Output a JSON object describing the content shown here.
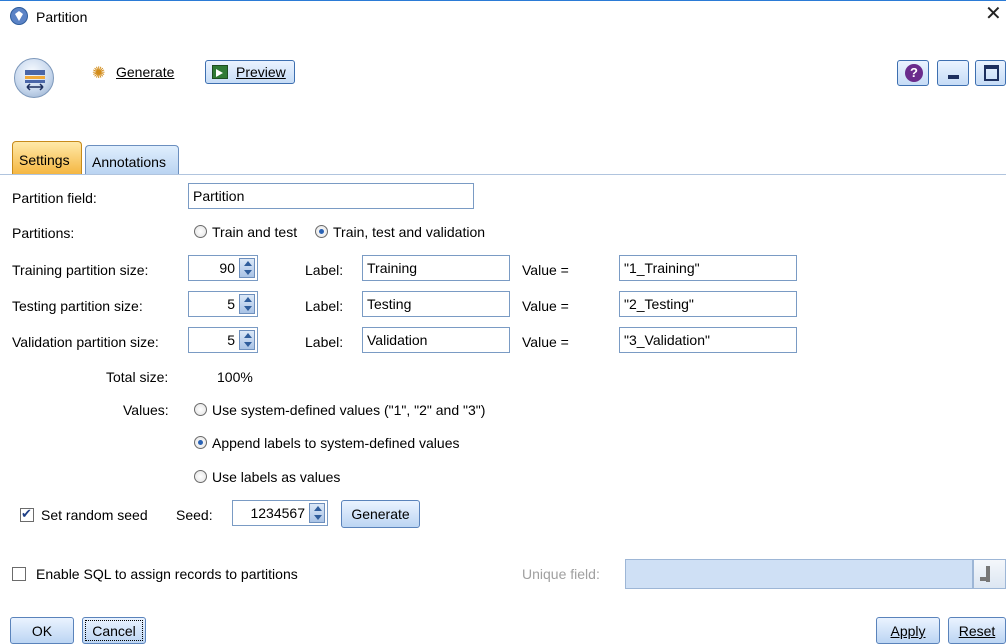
{
  "window": {
    "title": "Partition"
  },
  "toolbar": {
    "generate_label": "Generate",
    "preview_label": "Preview",
    "help_label": "?"
  },
  "tabs": [
    {
      "label": "Settings",
      "active": true
    },
    {
      "label": "Annotations",
      "active": false
    }
  ],
  "settings": {
    "partition_field": {
      "label": "Partition field:",
      "value": "Partition"
    },
    "partitions": {
      "label": "Partitions:",
      "options": [
        {
          "label": "Train and test",
          "selected": false
        },
        {
          "label": "Train, test and validation",
          "selected": true
        }
      ]
    },
    "rows": [
      {
        "label": "Training partition size:",
        "size": "90",
        "label_prefix": "Label:",
        "name": "Training",
        "value_prefix": "Value =",
        "value": "\"1_Training\""
      },
      {
        "label": "Testing partition size:",
        "size": "5",
        "label_prefix": "Label:",
        "name": "Testing",
        "value_prefix": "Value =",
        "value": "\"2_Testing\""
      },
      {
        "label": "Validation partition size:",
        "size": "5",
        "label_prefix": "Label:",
        "name": "Validation",
        "value_prefix": "Value =",
        "value": "\"3_Validation\""
      }
    ],
    "total": {
      "label": "Total size:",
      "value": "100%"
    },
    "values": {
      "label": "Values:",
      "options": [
        {
          "label": "Use system-defined values (\"1\", \"2\" and \"3\")",
          "selected": false
        },
        {
          "label": "Append labels to system-defined values",
          "selected": true
        },
        {
          "label": "Use labels as values",
          "selected": false
        }
      ]
    },
    "seed": {
      "checkbox_label": "Set random seed",
      "checked": true,
      "seed_label": "Seed:",
      "seed_value": "1234567",
      "generate_label": "Generate"
    },
    "sql": {
      "checkbox_label": "Enable SQL to assign records to partitions",
      "checked": false,
      "unique_field_label": "Unique field:"
    }
  },
  "footer": {
    "ok_label": "OK",
    "cancel_label": "Cancel",
    "apply_label": "Apply",
    "reset_label": "Reset"
  },
  "colors": {
    "accent": "#3d6fb0",
    "tab_active": "#f4b53f",
    "button_face": "#c6dcf6"
  }
}
